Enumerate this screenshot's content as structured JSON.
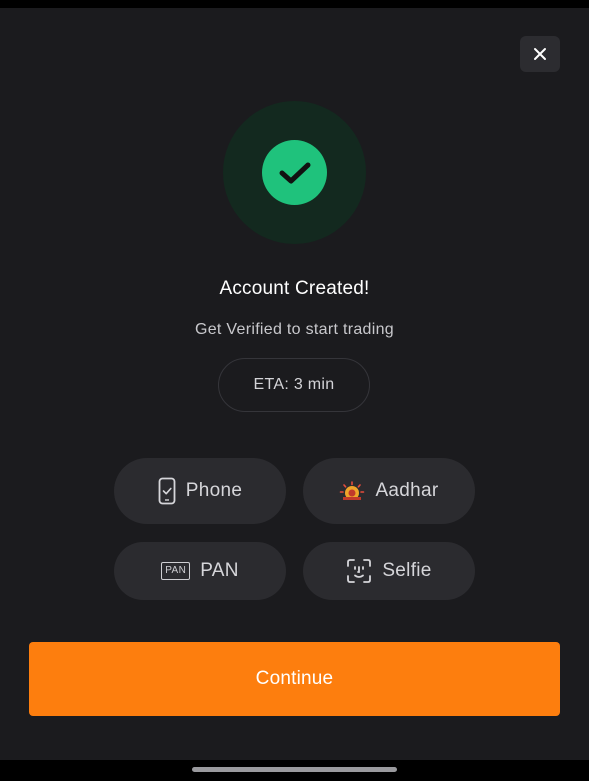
{
  "dialog": {
    "close_icon": "close-icon",
    "success_icon": "checkmark-icon",
    "title": "Account Created!",
    "subtitle": "Get Verified to start trading",
    "eta": "ETA: 3 min"
  },
  "verification_steps": [
    {
      "label": "Phone",
      "icon": "phone-check-icon"
    },
    {
      "label": "Aadhar",
      "icon": "aadhar-logo-icon"
    },
    {
      "label": "PAN",
      "icon": "pan-card-icon",
      "badge": "PAN"
    },
    {
      "label": "Selfie",
      "icon": "face-scan-icon"
    }
  ],
  "actions": {
    "continue_label": "Continue"
  },
  "colors": {
    "background": "#1b1b1e",
    "success_green": "#1fc27c",
    "success_ring": "#13291f",
    "accent_orange": "#fd7e0e",
    "chip_bg": "#2b2b2f"
  }
}
